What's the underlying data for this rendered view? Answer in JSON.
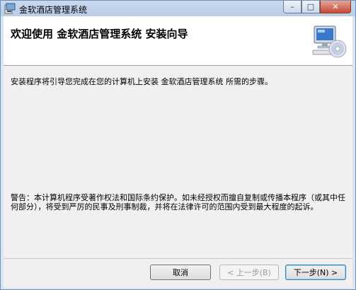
{
  "window": {
    "title": "金软酒店管理系统",
    "controls": {
      "minimize": "–",
      "maximize": "□",
      "close": "✕"
    }
  },
  "header": {
    "title": "欢迎使用 金软酒店管理系统 安装向导",
    "art_icon": "computer-cd-icon"
  },
  "body": {
    "intro": "安装程序将引导您完成在您的计算机上安装 金软酒店管理系统 所需的步骤。",
    "warning": "警告：本计算机程序受著作权法和国际条约保护。如未经授权而擅自复制或传播本程序（或其中任何部分），将受到严厉的民事及刑事制裁，并将在法律许可的范围内受到最大程度的起诉。"
  },
  "buttons": {
    "cancel": "取消",
    "back": "< 上一步(B)",
    "next": "下一步(N) >",
    "back_enabled": false
  },
  "colors": {
    "title_bar": "#c9d9ee",
    "header_bg": "#ffffff",
    "body_bg": "#f0f0f0",
    "close_btn": "#c64a34",
    "default_btn_border": "#3c7fb1"
  }
}
